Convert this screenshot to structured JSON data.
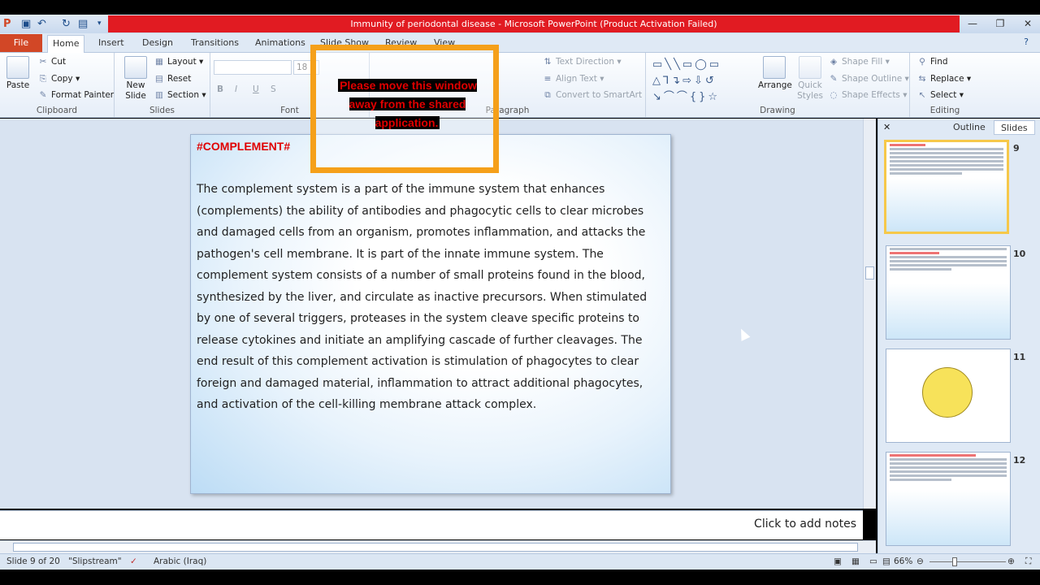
{
  "window": {
    "title": "Immunity of periodontal disease  -  Microsoft PowerPoint (Product Activation Failed)",
    "min": "—",
    "restore": "❐",
    "close": "✕"
  },
  "tabs": {
    "file": "File",
    "items": [
      "Home",
      "Insert",
      "Design",
      "Transitions",
      "Animations",
      "Slide Show",
      "Review",
      "View"
    ]
  },
  "clipboard": {
    "paste": "Paste",
    "cut": "Cut",
    "copy": "Copy",
    "format_painter": "Format Painter",
    "label": "Clipboard"
  },
  "slides_group": {
    "new_slide": "New Slide",
    "layout": "Layout",
    "reset": "Reset",
    "section": "Section",
    "label": "Slides"
  },
  "font": {
    "size": "18",
    "label": "Font"
  },
  "paragraph": {
    "text_direction": "Text Direction",
    "align_text": "Align Text",
    "convert": "Convert to SmartArt",
    "label": "Paragraph"
  },
  "drawing": {
    "arrange": "Arrange",
    "quick_styles": "Quick Styles",
    "shape_fill": "Shape Fill",
    "shape_outline": "Shape Outline",
    "shape_effects": "Shape Effects",
    "label": "Drawing"
  },
  "editing": {
    "find": "Find",
    "replace": "Replace",
    "select": "Select",
    "label": "Editing"
  },
  "slide": {
    "title": "#COMPLEMENT#",
    "body": "The complement system is a part of the immune system that enhances (complements) the ability of antibodies and phagocytic cells to clear microbes and damaged cells from an organism, promotes inflammation, and attacks the pathogen's cell membrane. It is part of the innate immune system. The complement system consists of a number of small proteins found in the blood, synthesized by the liver, and circulate as inactive precursors. When stimulated by one of several triggers, proteases in the system cleave specific proteins to release cytokines and initiate an amplifying cascade of further cleavages. The end result of this complement activation is stimulation of phagocytes to clear foreign and damaged material, inflammation to attract additional phagocytes, and activation of the cell-killing membrane attack complex."
  },
  "notes": {
    "placeholder": "Click to add notes"
  },
  "panel": {
    "outline_tab": "Outline",
    "slides_tab": "Slides",
    "close": "✕",
    "thumbs": [
      {
        "num": "9"
      },
      {
        "num": "10"
      },
      {
        "num": "11"
      },
      {
        "num": "12"
      }
    ]
  },
  "status": {
    "slide": "Slide 9 of 20",
    "theme": "\"Slipstream\"",
    "language": "Arabic (Iraq)",
    "zoom": "66%",
    "zoom_level": 0.66
  },
  "overlay": {
    "message": "Please move this window away from the shared application."
  },
  "colors": {
    "title_red": "#e11b22",
    "accent_orange": "#f5a01a",
    "file_tab": "#d24726"
  }
}
